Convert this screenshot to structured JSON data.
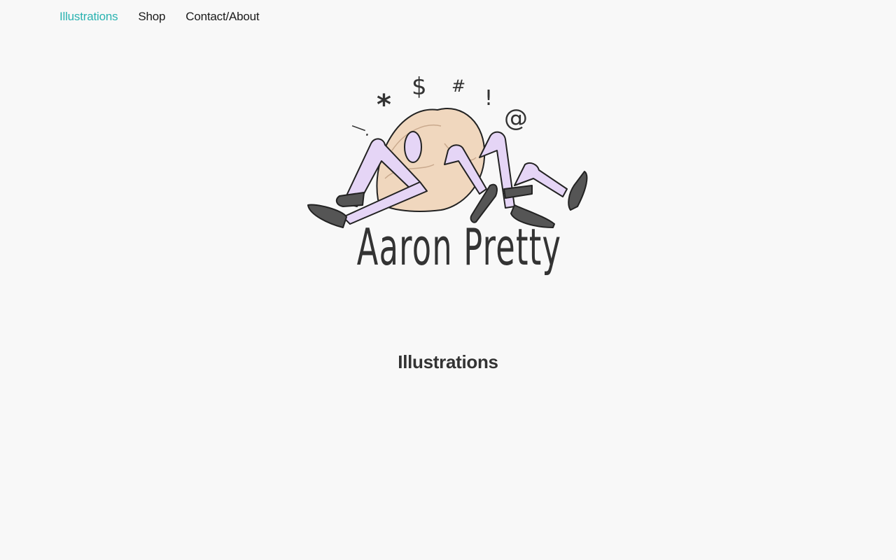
{
  "nav": {
    "items": [
      {
        "label": "Illustrations",
        "active": true
      },
      {
        "label": "Shop",
        "active": false
      },
      {
        "label": "Contact/About",
        "active": false
      }
    ],
    "active_color": "#2bb3b1"
  },
  "logo": {
    "text": "Aaron Pretty",
    "symbols": [
      "\\.",
      "*",
      "$",
      "#",
      "!",
      "@"
    ],
    "body_color": "#f0d7be",
    "leg_color": "#e5d5f6",
    "shoe_color": "#555555"
  },
  "main": {
    "section_title": "Illustrations"
  }
}
